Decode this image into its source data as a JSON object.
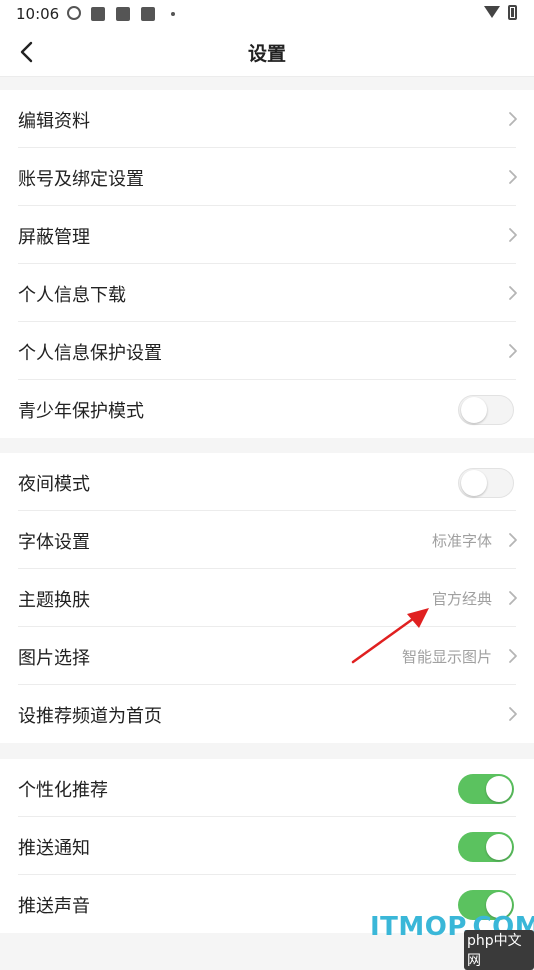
{
  "status_bar": {
    "time": "10:06"
  },
  "header": {
    "title": "设置"
  },
  "sections": [
    {
      "items": [
        {
          "label": "编辑资料",
          "type": "chevron"
        },
        {
          "label": "账号及绑定设置",
          "type": "chevron"
        },
        {
          "label": "屏蔽管理",
          "type": "chevron"
        },
        {
          "label": "个人信息下载",
          "type": "chevron"
        },
        {
          "label": "个人信息保护设置",
          "type": "chevron"
        },
        {
          "label": "青少年保护模式",
          "type": "toggle",
          "on": false
        }
      ]
    },
    {
      "items": [
        {
          "label": "夜间模式",
          "type": "toggle",
          "on": false
        },
        {
          "label": "字体设置",
          "type": "chevron",
          "value": "标准字体"
        },
        {
          "label": "主题换肤",
          "type": "chevron",
          "value": "官方经典"
        },
        {
          "label": "图片选择",
          "type": "chevron",
          "value": "智能显示图片"
        },
        {
          "label": "设推荐频道为首页",
          "type": "chevron"
        }
      ]
    },
    {
      "items": [
        {
          "label": "个性化推荐",
          "type": "toggle",
          "on": true
        },
        {
          "label": "推送通知",
          "type": "toggle",
          "on": true
        },
        {
          "label": "推送声音",
          "type": "toggle",
          "on": true
        }
      ]
    }
  ],
  "watermark": {
    "main": "ITMOP.COM",
    "sub": "php中文网"
  },
  "colors": {
    "toggle_on": "#5bc25f",
    "toggle_off": "#f4f4f4",
    "annotation_arrow": "#e02020",
    "watermark": "#3ab7d8"
  }
}
